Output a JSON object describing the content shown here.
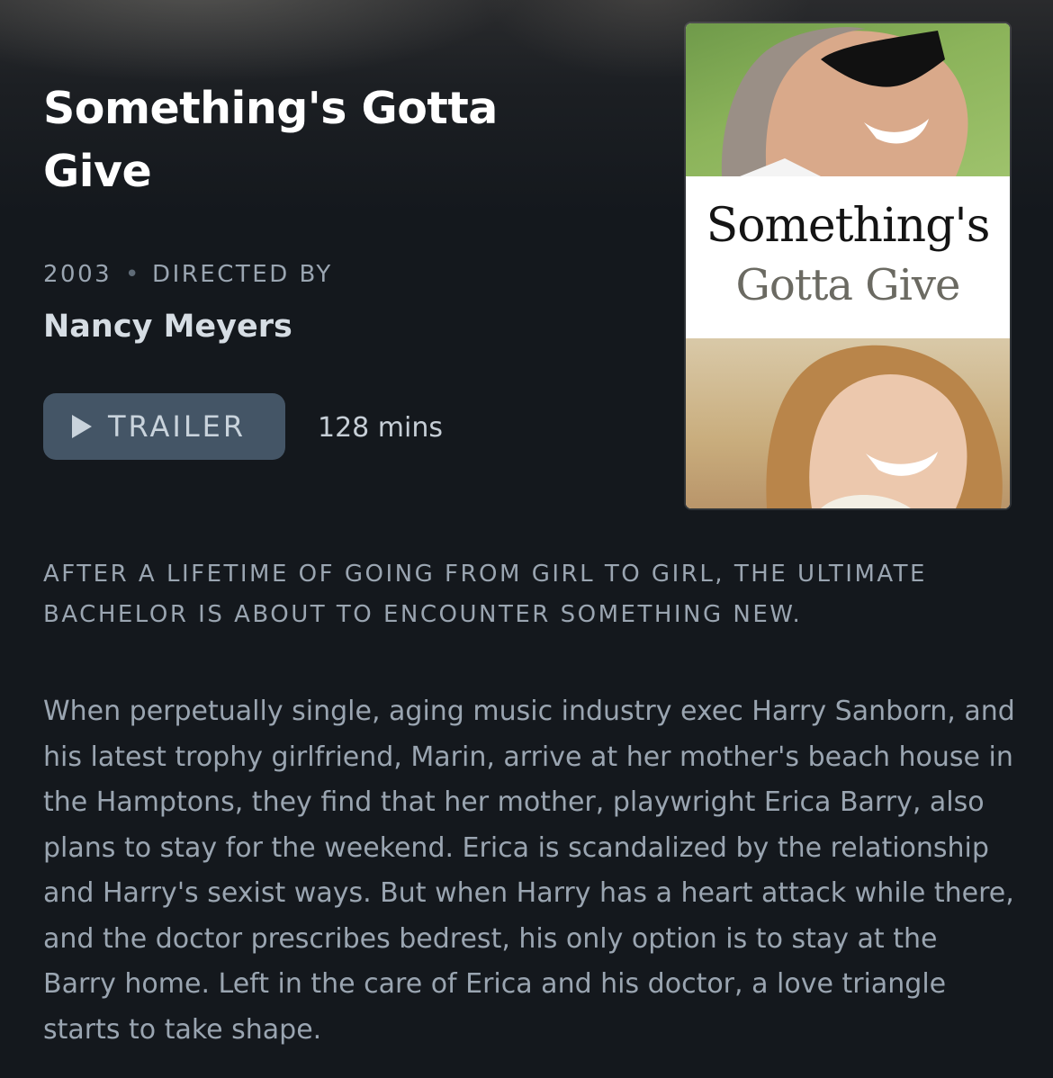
{
  "film": {
    "title": "Something's Gotta Give",
    "year": "2003",
    "meta_separator": "•",
    "directed_by_label": "DIRECTED BY",
    "director": "Nancy Meyers",
    "trailer_label": "TRAILER",
    "runtime": "128 mins",
    "poster": {
      "title_line1": "Something's",
      "title_line2": "Gotta Give"
    },
    "tagline": "AFTER A LIFETIME OF GOING FROM GIRL TO GIRL, THE ULTIMATE BACHELOR IS ABOUT TO ENCOUNTER SOMETHING NEW.",
    "synopsis": "When perpetually single, aging music industry exec Harry Sanborn, and his latest trophy girlfriend, Marin, arrive at her mother's beach house in the Hamptons, they find that her mother, playwright Erica Barry, also plans to stay for the weekend. Erica is scandalized by the relationship and Harry's sexist ways. But when Harry has a heart attack while there, and the doctor prescribes bedrest, his only option is to stay at the Barry home. Left in the care of Erica and his doctor, a love triangle starts to take shape."
  },
  "icons": {
    "trailer": "play-icon"
  },
  "colors": {
    "background": "#14181d",
    "title": "#ffffff",
    "muted_text": "#9aa5b1",
    "director": "#d6dde4",
    "button_bg": "#445566",
    "button_text": "#c9d3dc"
  }
}
